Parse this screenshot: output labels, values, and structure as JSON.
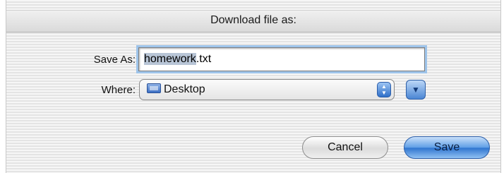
{
  "dialog": {
    "title": "Download file as:",
    "background_title_fragment": "...",
    "save_as_label": "Save As:",
    "filename_selected": "homework",
    "filename_ext": ".txt",
    "where_label": "Where:",
    "where_value": "Desktop",
    "folder_icon": "folder-icon",
    "expand_icon": "triangle-down-icon",
    "cancel_label": "Cancel",
    "save_label": "Save"
  },
  "colors": {
    "accent": "#4b86d4",
    "selection": "#b8c5d6",
    "focus_ring": "#9ec4ea"
  }
}
